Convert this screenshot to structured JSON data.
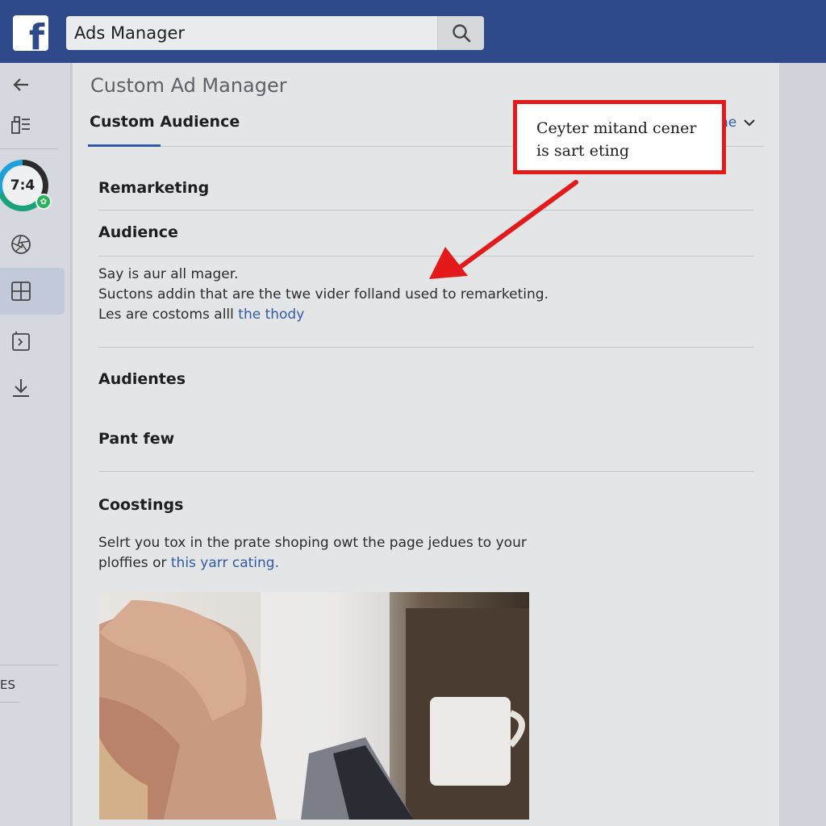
{
  "topbar": {
    "logo": "f",
    "search": {
      "value": "Ads Manager",
      "placeholder": "Ads Manager"
    }
  },
  "rail": {
    "timer_value": "7:4",
    "es_label": "ES"
  },
  "main": {
    "page_title": "Custom Ad Manager",
    "tab_label": "Custom Audience",
    "tab_more_label": "ne",
    "sections": {
      "remarketing": "Remarketing",
      "audience": "Audience",
      "audience_line1": "Say is aur all mager.",
      "audience_line2": "Suctons addin that are the twe vider folland used to remarketing.",
      "audience_line3": "Les are costoms alll",
      "audience_link": "the thody",
      "audientes": "Audientes",
      "pant_few": "Pant few",
      "coostings": "Coostings",
      "coostings_line1": "Selrt you tox in the prate shoping owt the page jedues to your",
      "coostings_line2": "ploffies or",
      "coostings_link": "this yarr cating."
    }
  },
  "annotation": {
    "line1": "Ceyter mitand cener",
    "line2": "is sart eting",
    "color": "#e41a1a"
  },
  "colors": {
    "topbar": "#2f4a8a",
    "accent": "#2f5ba7",
    "timer_green": "#1aa37a",
    "timer_blue": "#1da1d8"
  }
}
